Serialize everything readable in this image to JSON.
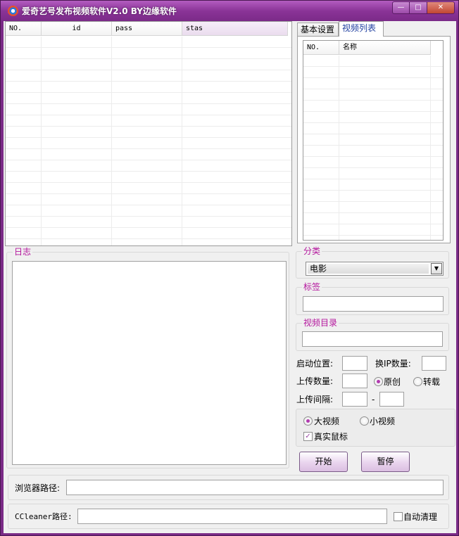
{
  "window": {
    "title": "爱奇艺号发布视频软件V2.0 BY边缘软件",
    "minimize": "—",
    "maximize": "□",
    "close": "✕"
  },
  "accounts_list": {
    "columns": [
      "NO.",
      "id",
      "pass",
      "stas"
    ]
  },
  "tabs": [
    {
      "label": "基本设置",
      "active": false
    },
    {
      "label": "视频列表",
      "active": true
    }
  ],
  "video_list": {
    "columns": [
      "NO.",
      "名称"
    ]
  },
  "log": {
    "label": "日志"
  },
  "category": {
    "label": "分类",
    "value": "电影"
  },
  "tags": {
    "label": "标签",
    "value": ""
  },
  "video_dir": {
    "label": "视频目录",
    "value": ""
  },
  "settings": {
    "start_position_label": "启动位置:",
    "change_ip_label": "换IP数量:",
    "upload_count_label": "上传数量:",
    "original_label": "原创",
    "original_selected": true,
    "repost_label": "转载",
    "repost_selected": false,
    "upload_interval_label": "上传间隔:",
    "interval_separator": "-"
  },
  "video_size": {
    "large_label": "大视频",
    "large_selected": true,
    "small_label": "小视频",
    "small_selected": false,
    "real_mouse_label": "真实鼠标",
    "real_mouse_checked": true
  },
  "buttons": {
    "start": "开始",
    "pause": "暂停"
  },
  "browser": {
    "label": "浏览器路径:",
    "value": ""
  },
  "ccleaner": {
    "label": "CCleaner路径:",
    "value": "",
    "auto_clean_label": "自动清理",
    "auto_clean_checked": false
  }
}
